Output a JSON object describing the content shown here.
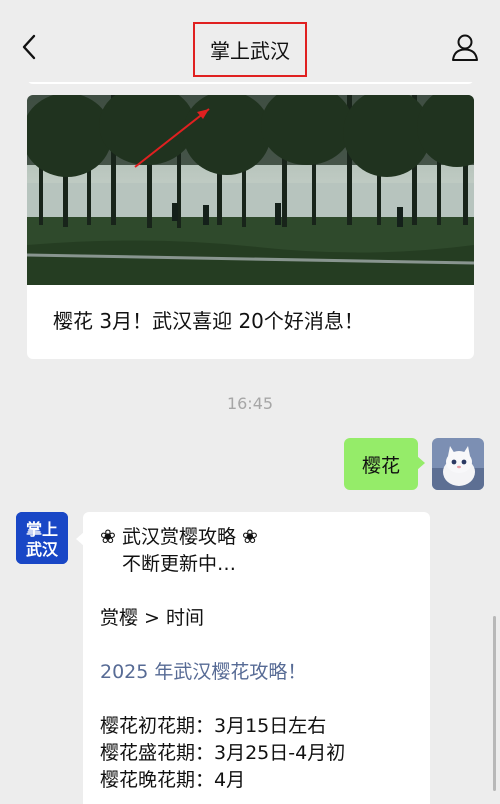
{
  "nav": {
    "title": "掌上武汉",
    "back_icon": "chevron-left-icon",
    "profile_icon": "person-icon"
  },
  "article": {
    "title": "樱花 3月！武汉喜迎 20个好消息！"
  },
  "time": "16:45",
  "user_message": "樱花",
  "bot_avatar_text": [
    "掌上",
    "武汉"
  ],
  "bot_message": {
    "line1": "❀ 武汉赏樱攻略 ❀",
    "line2": "不断更新中…",
    "line3": "赏樱 > 时间",
    "link": "2025 年武汉樱花攻略！",
    "period1": "樱花初花期：3月15日左右",
    "period2": "樱花盛花期：3月25日-4月初",
    "period3": "樱花晚花期：4月"
  },
  "colors": {
    "background": "#ededed",
    "my_bubble": "#95ec69",
    "link": "#576b95",
    "highlight_box": "#e02020",
    "bot_avatar": "#1947c6"
  }
}
